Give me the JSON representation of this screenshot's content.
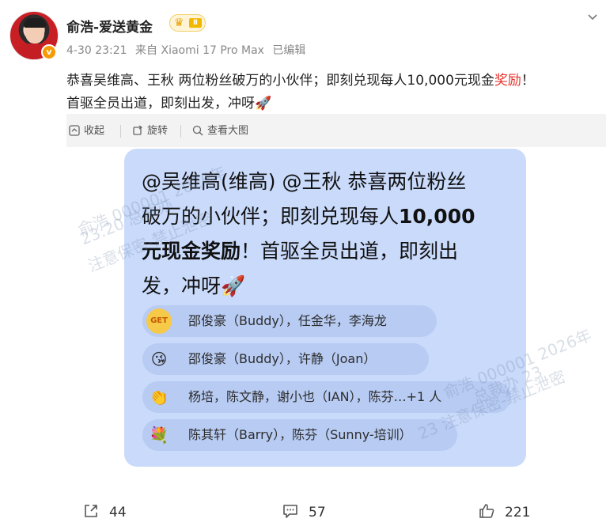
{
  "post": {
    "author": "俞浩-爱送黄金",
    "vip_level": "Ⅱ",
    "verified_badge": "v",
    "meta": {
      "date": "4-30 23:21",
      "source": "来自 Xiaomi 17 Pro Max",
      "edited": "已编辑"
    },
    "text_line1_before": "恭喜吴维高、王秋 两位粉丝破万的小伙伴；即刻兑现每人10,000元现金",
    "text_line1_highlight": "奖励",
    "text_line1_after": "！",
    "text_line2": "首驱全员出道，即刻出发，冲呀🚀"
  },
  "media_toolbar": {
    "collapse": "收起",
    "rotate": "旋转",
    "view_large": "查看大图"
  },
  "image": {
    "bubble_line1": "@吴维高(维高) @王秋 恭喜两位粉丝",
    "bubble_line2_a": "破万的小伙伴；即刻兑现每人",
    "bubble_line2_b": "10,000",
    "bubble_line3_a": "元现金奖励",
    "bubble_line3_b": "！首驱全员出道，即刻出",
    "bubble_line4": "发，冲呀🚀",
    "reactions": [
      {
        "emoji": "GET",
        "names": "邵俊豪（Buddy），任金华，李海龙"
      },
      {
        "emoji": "😘",
        "names": "邵俊豪（Buddy），许静（Joan）"
      },
      {
        "emoji": "👏",
        "names": "杨培，陈文静，谢小也（IAN），陈芬…+1 人"
      },
      {
        "emoji": "💐",
        "names": "陈其轩（Barry），陈芬（Sunny-培训）"
      }
    ],
    "watermarks": [
      "俞浩 000001 2026年",
      "23:20 总裁办",
      "注意保密-禁止泄密",
      "俞浩 000001 2026年",
      "总裁办 23",
      "23 注意保密-禁止泄密"
    ]
  },
  "footer": {
    "share_count": "44",
    "comment_count": "57",
    "like_count": "221"
  },
  "colors": {
    "highlight": "#e7312b",
    "bubble": "#c9dafb",
    "reaction_pill": "#b7cbf3"
  }
}
